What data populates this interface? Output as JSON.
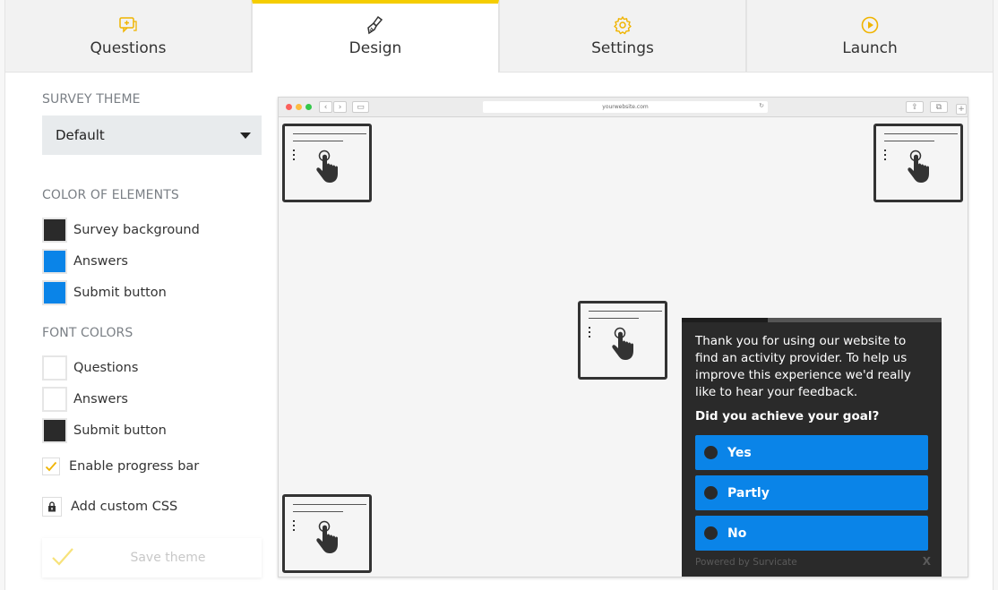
{
  "tabs": [
    {
      "label": "Questions",
      "icon": "questions-icon",
      "active": false
    },
    {
      "label": "Design",
      "icon": "brush-icon",
      "active": true
    },
    {
      "label": "Settings",
      "icon": "gear-icon",
      "active": false
    },
    {
      "label": "Launch",
      "icon": "play-icon",
      "active": false
    }
  ],
  "accent_color": "#f5cd00",
  "theme": {
    "section_title": "SURVEY THEME",
    "selected": "Default"
  },
  "element_colors": {
    "section_title": "COLOR OF ELEMENTS",
    "items": [
      {
        "label": "Survey background",
        "color": "#2a2a2a"
      },
      {
        "label": "Answers",
        "color": "#0a84e8"
      },
      {
        "label": "Submit button",
        "color": "#0a84e8"
      }
    ]
  },
  "font_colors": {
    "section_title": "FONT COLORS",
    "items": [
      {
        "label": "Questions",
        "color": "#ffffff"
      },
      {
        "label": "Answers",
        "color": "#ffffff"
      },
      {
        "label": "Submit button",
        "color": "#2a2a2a"
      }
    ]
  },
  "options": {
    "progress_bar_label": "Enable progress bar",
    "progress_bar_checked": true,
    "custom_css_label": "Add custom CSS"
  },
  "save_button_label": "Save theme",
  "preview": {
    "url": "yourwebsite.com",
    "survey": {
      "progress": 0.33,
      "intro": "Thank you for using our website to find an activity provider. To help us improve this experience we'd really like to hear your feedback.",
      "question": "Did you achieve your goal?",
      "answers": [
        "Yes",
        "Partly",
        "No"
      ],
      "powered_by": "Powered by Survicate",
      "close_label": "X"
    }
  }
}
